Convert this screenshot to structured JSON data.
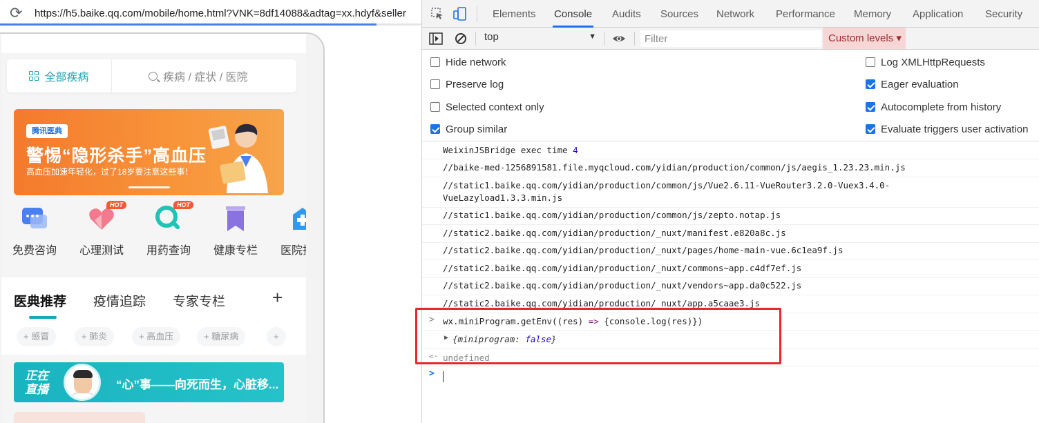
{
  "browser": {
    "url": "https://h5.baike.qq.com/mobile/home.html?VNK=8df14088&adtag=xx.hdyf&seller"
  },
  "app": {
    "all_diseases_label": "全部疾病",
    "search_placeholder": "疾病 / 症状 / 医院",
    "banner": {
      "brand": "腾讯医典",
      "title": "警惕“隐形杀手”高血压",
      "subtitle": "高血压加速年轻化，过了18岁要注意这些事！"
    },
    "quick_items": [
      {
        "label": "免费咨询",
        "icon": "chat-bubble-icon",
        "hot": false,
        "color": "#4a7ff0"
      },
      {
        "label": "心理测试",
        "icon": "heart-icon",
        "hot": true,
        "color": "#f27a8c"
      },
      {
        "label": "用药查询",
        "icon": "pill-search-icon",
        "hot": true,
        "color": "#1ec4b6"
      },
      {
        "label": "健康专栏",
        "icon": "bookmark-icon",
        "hot": false,
        "color": "#8a72e0"
      },
      {
        "label": "医院排行",
        "icon": "hospital-icon",
        "hot": false,
        "color": "#2f9bf0"
      }
    ],
    "hot_badge": "HOT",
    "tabs": [
      "医典推荐",
      "疫情追踪",
      "专家专栏"
    ],
    "tab_add": "+",
    "tags": [
      "+ 感冒",
      "+ 肺炎",
      "+ 高血压",
      "+ 糖尿病",
      "+"
    ],
    "live": {
      "tag_line1": "正在",
      "tag_line2": "直播",
      "title": "“心”事——向死而生，心脏移..."
    }
  },
  "devtools": {
    "tabs": [
      "Elements",
      "Console",
      "Audits",
      "Sources",
      "Network",
      "Performance",
      "Memory",
      "Application",
      "Security"
    ],
    "active_tab": "Console",
    "context": "top",
    "filter_placeholder": "Filter",
    "levels_label": "Custom levels ▾",
    "settings_left": [
      {
        "label": "Hide network",
        "checked": false
      },
      {
        "label": "Preserve log",
        "checked": false
      },
      {
        "label": "Selected context only",
        "checked": false
      },
      {
        "label": "Group similar",
        "checked": true
      }
    ],
    "settings_right": [
      {
        "label": "Log XMLHttpRequests",
        "checked": false
      },
      {
        "label": "Eager evaluation",
        "checked": true
      },
      {
        "label": "Autocomplete from history",
        "checked": true
      },
      {
        "label": "Evaluate triggers user activation",
        "checked": true
      }
    ],
    "log": {
      "exec_text": "WeixinJSBridge exec time ",
      "exec_value": "4",
      "lines": [
        "//baike-med-1256891581.file.myqcloud.com/yidian/production/common/js/aegis_1.23.23.min.js",
        "//static1.baike.qq.com/yidian/production/common/js/Vue2.6.11-VueRouter3.2.0-Vuex3.4.0-",
        "VueLazyload1.3.3.min.js",
        "//static1.baike.qq.com/yidian/production/common/js/zepto.notap.js",
        "//static2.baike.qq.com/yidian/production/_nuxt/manifest.e820a8c.js",
        "//static2.baike.qq.com/yidian/production/_nuxt/pages/home-main-vue.6c1ea9f.js",
        "//static2.baike.qq.com/yidian/production/_nuxt/commons~app.c4df7ef.js",
        "//static2.baike.qq.com/yidian/production/_nuxt/vendors~app.da0c522.js",
        "//static2.baike.qq.com/yidian/production/_nuxt/app.a5caae3.js"
      ],
      "command_a": "wx.miniProgram.getEnv((res) ",
      "command_arrow": "=>",
      "command_b": " {console.log(res)})",
      "result_open": "{miniprogram: ",
      "result_value": "false",
      "result_close": "}",
      "return_value": "undefined"
    }
  }
}
